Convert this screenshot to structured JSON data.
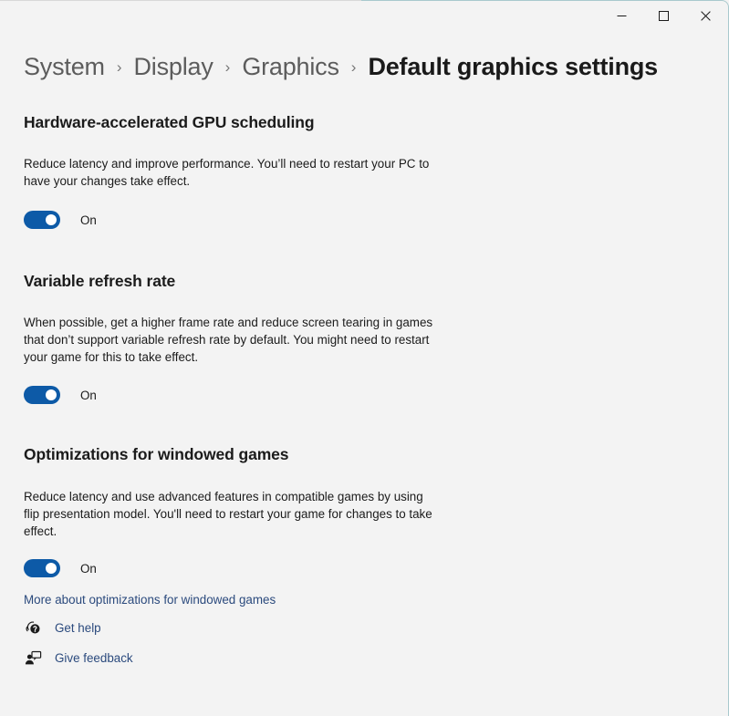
{
  "window": {
    "caption_buttons": [
      {
        "name": "minimize",
        "label": "Minimize"
      },
      {
        "name": "maximize",
        "label": "Maximize"
      },
      {
        "name": "close",
        "label": "Close"
      }
    ],
    "accent_color": "#a9c9cd",
    "background_color": "#f3f3f3"
  },
  "breadcrumb": {
    "separator": "›",
    "items": [
      {
        "label": "System",
        "current": false
      },
      {
        "label": "Display",
        "current": false
      },
      {
        "label": "Graphics",
        "current": false
      },
      {
        "label": "Default graphics settings",
        "current": true
      }
    ]
  },
  "sections": [
    {
      "title": "Hardware-accelerated GPU scheduling",
      "description": "Reduce latency and improve performance. You’ll need to restart your PC to have your changes take effect.",
      "toggle_state": "On",
      "toggle_on": true
    },
    {
      "title": "Variable refresh rate",
      "description": "When possible, get a higher frame rate and reduce screen tearing in games that don’t support variable refresh rate by default. You might need to restart your game for this to take effect.",
      "toggle_state": "On",
      "toggle_on": true
    },
    {
      "title": "Optimizations for windowed games",
      "description": "Reduce latency and use advanced features in compatible games by using flip presentation model. You'll need to restart your game for changes to take effect.",
      "toggle_state": "On",
      "toggle_on": true,
      "link": "More about optimizations for windowed games"
    }
  ],
  "footer": {
    "links": [
      {
        "label": "Get help",
        "icon": "get-help-icon"
      },
      {
        "label": "Give feedback",
        "icon": "give-feedback-icon"
      }
    ],
    "link_color": "#2b4a7d"
  },
  "toggle": {
    "on_color": "#0d5aa7",
    "knob_color": "#ffffff"
  }
}
